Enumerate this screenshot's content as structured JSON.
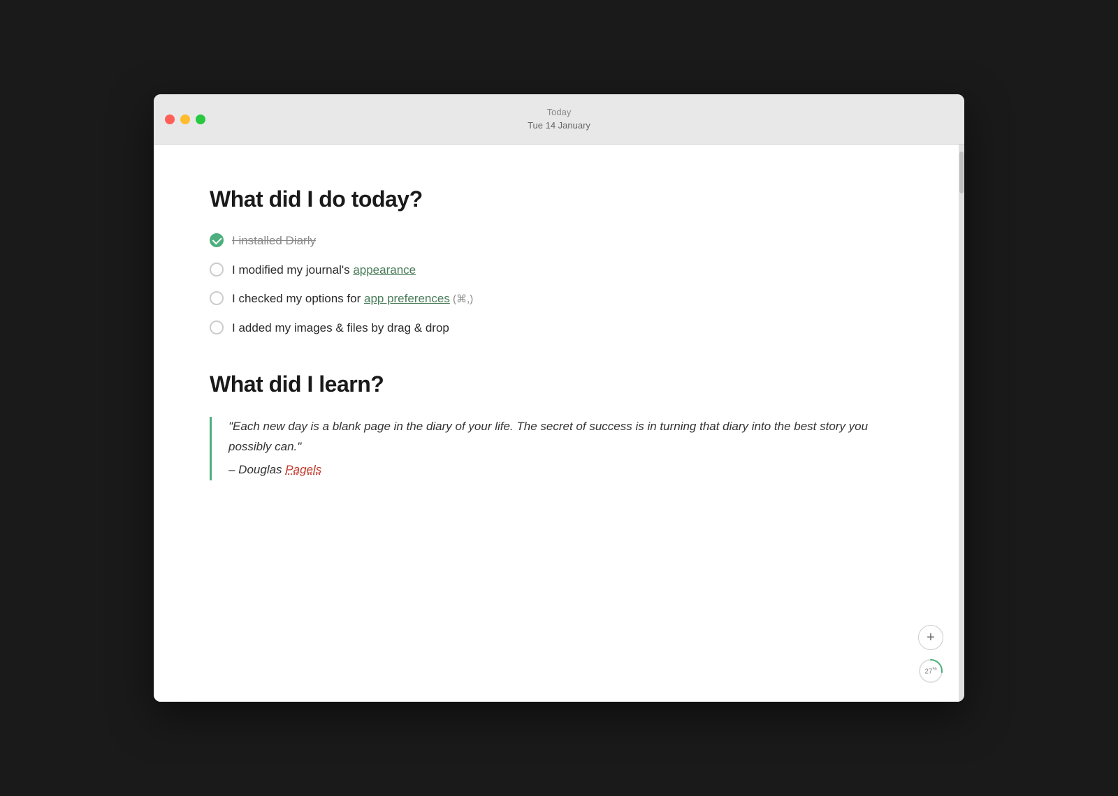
{
  "window": {
    "title_today": "Today",
    "title_date": "Tue 14 January"
  },
  "section1": {
    "heading": "What did I do today?"
  },
  "checklist": [
    {
      "id": "item1",
      "text": "I installed Diarly",
      "checked": true,
      "has_link": false
    },
    {
      "id": "item2",
      "text_before": "I modified my journal's ",
      "link_text": "appearance",
      "text_after": "",
      "checked": false,
      "has_link": true
    },
    {
      "id": "item3",
      "text_before": "I checked my options for ",
      "link_text": "app preferences",
      "text_after": " (⌘,)",
      "checked": false,
      "has_link": true
    },
    {
      "id": "item4",
      "text": "I added my images & files by drag & drop",
      "checked": false,
      "has_link": false
    }
  ],
  "section2": {
    "heading": "What did I learn?"
  },
  "blockquote": {
    "text": "\"Each new day is a blank page in the diary of your life. The secret of success is in turning that diary into the best story you possibly can.\"",
    "attribution_prefix": "– Douglas ",
    "attribution_author": "Pagels"
  },
  "controls": {
    "add_button_label": "+",
    "progress_percent": "27",
    "progress_sup": "%"
  },
  "colors": {
    "check_green": "#4caf7d",
    "link_green": "#4a7c59",
    "blockquote_bar": "#4caf7d",
    "author_red": "#c0392b"
  }
}
